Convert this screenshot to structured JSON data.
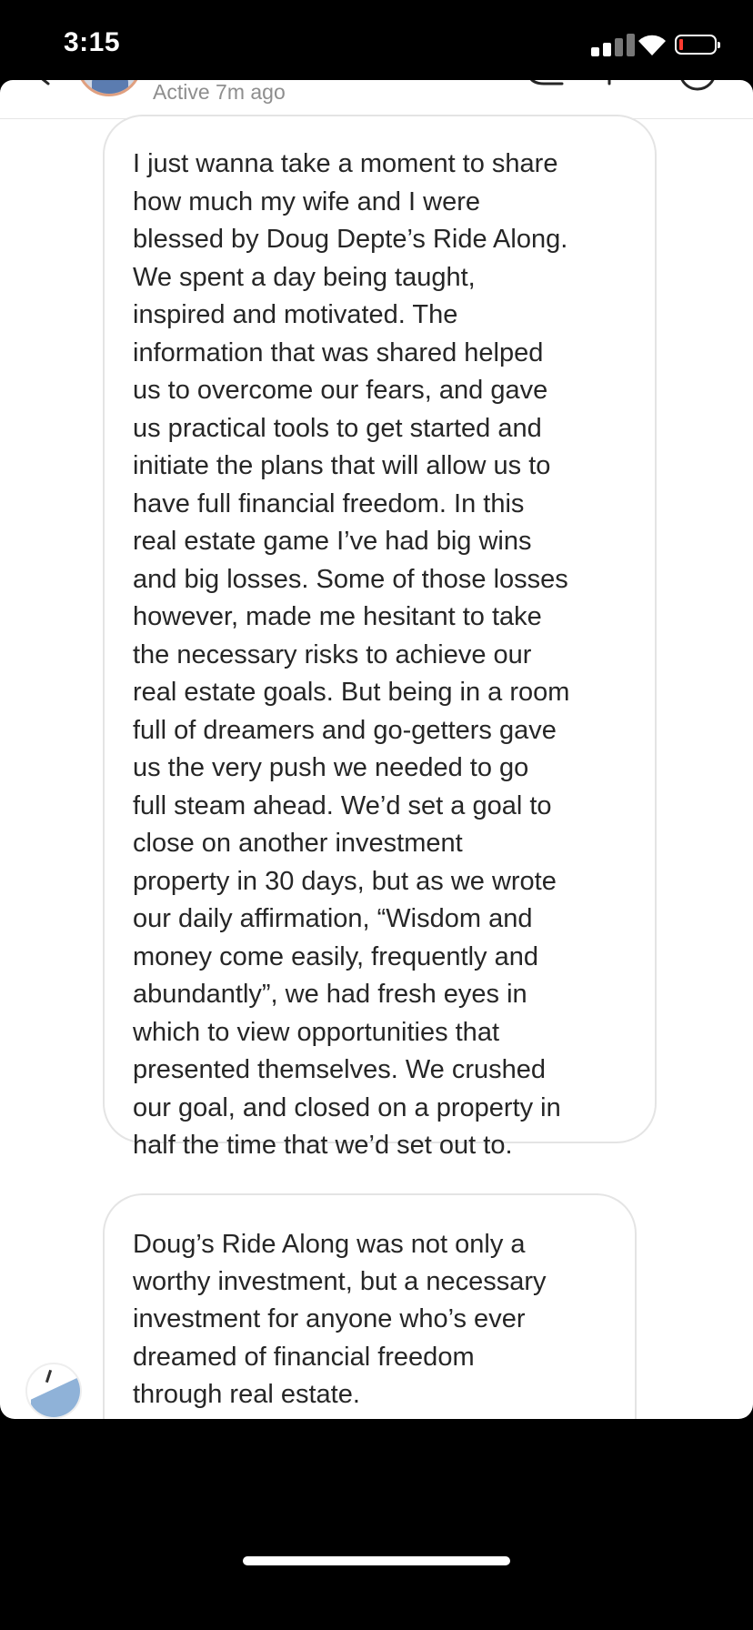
{
  "status_bar": {
    "time": "3:15",
    "battery_color": "#ff3b30"
  },
  "header": {
    "active_status": "Active 7m ago",
    "icons": [
      "back-chevron-icon",
      "avatar",
      "phone-call-icon",
      "video-call-icon",
      "info-icon"
    ]
  },
  "messages": [
    {
      "lines": [
        "I just wanna take a moment to share",
        "how much my wife and I were",
        "blessed by Doug Depte’s Ride Along.",
        "We spent a day being taught,",
        "inspired and motivated. The",
        "information that was shared helped",
        "us to overcome our fears, and gave",
        "us practical tools to get started and",
        "initiate the plans that will allow us to",
        "have full financial freedom. In this",
        "real estate game I’ve had big wins",
        "and big losses. Some of those losses",
        "however, made me hesitant to take",
        "the necessary risks to achieve our",
        "real estate goals. But being in a room",
        "full of dreamers and go-getters gave",
        "us the very push we needed to go",
        "full steam ahead. We’d set a goal to",
        "close on another investment",
        "property in 30 days, but as we wrote",
        "our daily affirmation, “Wisdom and",
        "money come easily, frequently and",
        "abundantly”, we had fresh eyes in",
        "which to view opportunities that",
        "presented themselves. We crushed",
        "our goal, and closed on a property in",
        "half the time that we’d set out to."
      ]
    },
    {
      "lines": [
        "Doug’s Ride Along was not only a",
        "worthy investment, but a necessary",
        "investment for anyone who’s ever",
        "dreamed of financial freedom",
        "through real estate."
      ]
    }
  ]
}
